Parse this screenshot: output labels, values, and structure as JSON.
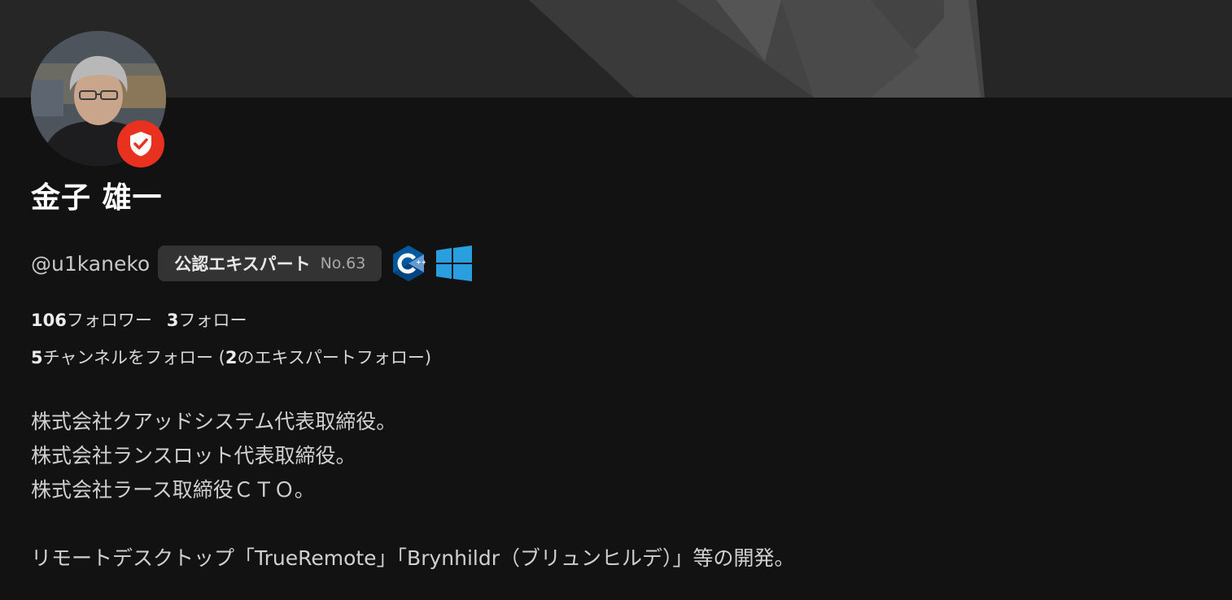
{
  "profile": {
    "name": "金子 雄一",
    "handle": "@u1kaneko",
    "expert_badge": {
      "label": "公認エキスパート",
      "number": "No.63"
    },
    "skill_icons": [
      "cpp-icon",
      "windows-icon"
    ],
    "verified_icon": "shield-check-icon",
    "verified_color": "#e8321f"
  },
  "stats": {
    "followers_count": "106",
    "followers_label": "フォロワー",
    "following_count": "3",
    "following_label": "フォロー"
  },
  "channels": {
    "count": "5",
    "label": "チャンネルをフォロー (",
    "expert_count": "2",
    "expert_label": "のエキスパートフォロー)"
  },
  "bio": {
    "lines": [
      "株式会社クアッドシステム代表取締役。",
      "株式会社ランスロット代表取締役。",
      "株式会社ラース取締役ＣＴＯ。",
      "",
      "リモートデスクトップ「TrueRemote」「Brynhildr（ブリュンヒルデ）」等の開発。"
    ]
  }
}
